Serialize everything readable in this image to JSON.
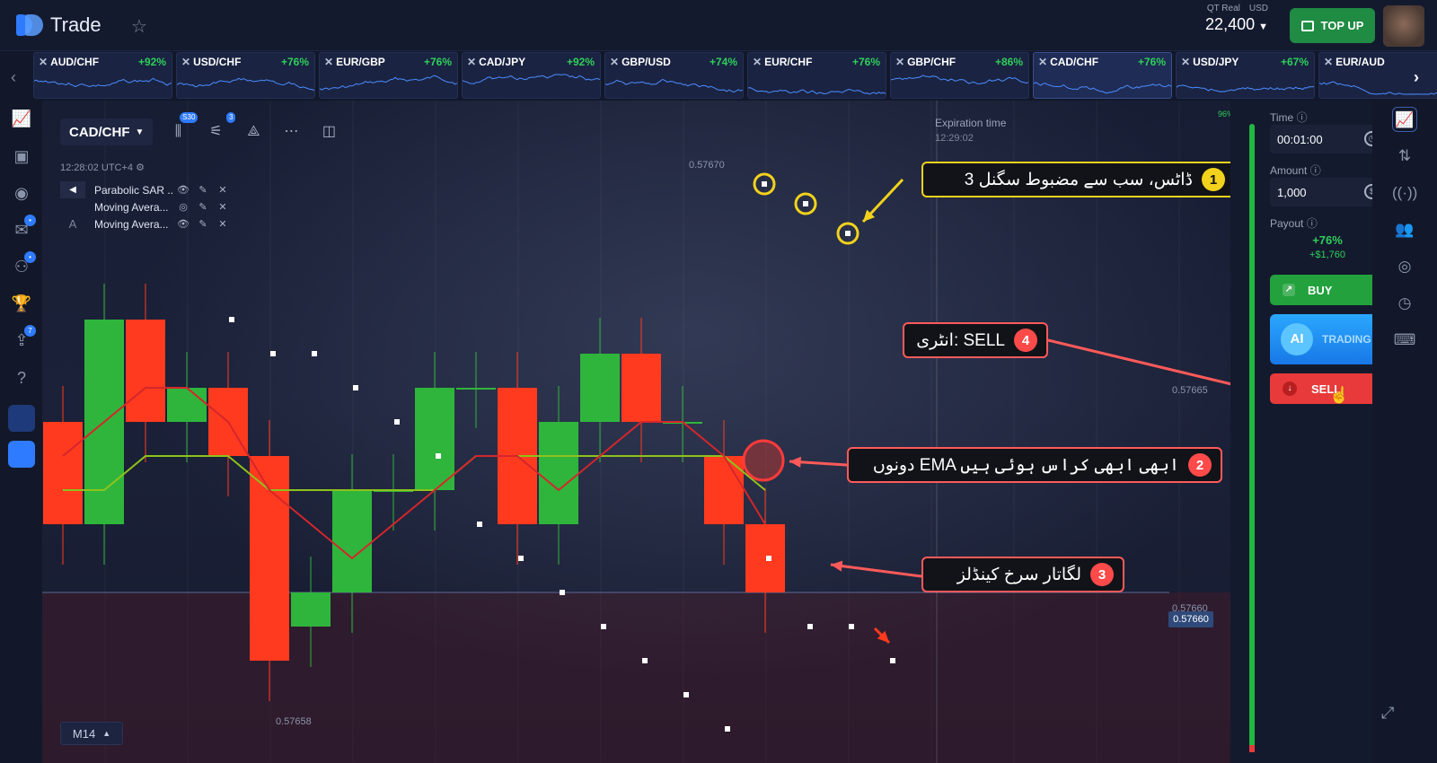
{
  "header": {
    "logo_text": "Trade",
    "account_label": "QT Real",
    "currency": "USD",
    "balance": "22,400",
    "topup_label": "TOP UP"
  },
  "tickers": [
    {
      "pair": "AUD/CHF",
      "payout": "+92%"
    },
    {
      "pair": "USD/CHF",
      "payout": "+76%"
    },
    {
      "pair": "EUR/GBP",
      "payout": "+76%"
    },
    {
      "pair": "CAD/JPY",
      "payout": "+92%"
    },
    {
      "pair": "GBP/USD",
      "payout": "+74%"
    },
    {
      "pair": "EUR/CHF",
      "payout": "+76%"
    },
    {
      "pair": "GBP/CHF",
      "payout": "+86%"
    },
    {
      "pair": "CAD/CHF",
      "payout": "+76%"
    },
    {
      "pair": "USD/JPY",
      "payout": "+67%"
    },
    {
      "pair": "EUR/AUD",
      "payout": ""
    }
  ],
  "chart_panel": {
    "pair": "CAD/CHF",
    "badge_candles": "S30",
    "badge_indicators": "3",
    "clock": "12:28:02 UTC+4",
    "indicators": [
      "Parabolic SAR ...",
      "Moving Avera...",
      "Moving Avera..."
    ],
    "timeframe": "M14",
    "expiration_label": "Expiration time",
    "expiration_time": "12:29:02",
    "price_top": "0.57670",
    "price_mid": "0.57665",
    "price_low": "0.57660",
    "price_current": "0.57660",
    "price_bottom": "0.57658",
    "sentiment": "96%"
  },
  "annotations": {
    "a1": {
      "num": "1",
      "text": "3 ڈاٹس، سب سے مضبوط سگنل"
    },
    "a2": {
      "num": "2",
      "text": "دونوں EMA ابھی ابھی کراس ہوئی ہیں"
    },
    "a3": {
      "num": "3",
      "text": "لگاتار سرخ کینڈلز"
    },
    "a4": {
      "num": "4",
      "text": "انٹری: SELL"
    }
  },
  "trade_panel": {
    "time_label": "Time",
    "time_value": "00:01:00",
    "amount_label": "Amount",
    "amount_value": "1,000",
    "payout_label": "Payout",
    "payout_percent": "+76%",
    "payout_amount": "+$1,760",
    "buy_label": "BUY",
    "ai_label": "AI",
    "ai_trading_label": "TRADING",
    "sell_label": "SELL"
  },
  "colors": {
    "bull": "#2fb53c",
    "bear": "#ff3a1f",
    "ema_fast": "#d4262c",
    "ema_slow": "#8ec21c",
    "annotation_yellow": "#f2d21c",
    "annotation_red": "#ff5a5a"
  },
  "chart_data": {
    "type": "candlestick",
    "candles": [
      {
        "dir": "down",
        "open": 0.57665,
        "close": 0.57662
      },
      {
        "dir": "up",
        "open": 0.57662,
        "close": 0.57668
      },
      {
        "dir": "down",
        "open": 0.57668,
        "close": 0.57665
      },
      {
        "dir": "up",
        "open": 0.57665,
        "close": 0.57666
      },
      {
        "dir": "down",
        "open": 0.57666,
        "close": 0.57664
      },
      {
        "dir": "down",
        "open": 0.57664,
        "close": 0.57658
      },
      {
        "dir": "up",
        "open": 0.57659,
        "close": 0.5766
      },
      {
        "dir": "up",
        "open": 0.5766,
        "close": 0.57663
      },
      {
        "dir": "up",
        "open": 0.57663,
        "close": 0.57663
      },
      {
        "dir": "up",
        "open": 0.57663,
        "close": 0.57666
      },
      {
        "dir": "up",
        "open": 0.57666,
        "close": 0.57666
      },
      {
        "dir": "down",
        "open": 0.57666,
        "close": 0.57662
      },
      {
        "dir": "up",
        "open": 0.57662,
        "close": 0.57665
      },
      {
        "dir": "up",
        "open": 0.57665,
        "close": 0.57667
      },
      {
        "dir": "down",
        "open": 0.57667,
        "close": 0.57665
      },
      {
        "dir": "up",
        "open": 0.57665,
        "close": 0.57665
      },
      {
        "dir": "down",
        "open": 0.57664,
        "close": 0.57662
      },
      {
        "dir": "down",
        "open": 0.57662,
        "close": 0.5766
      }
    ],
    "ema_fast": [
      0.57664,
      0.57665,
      0.57666,
      0.57666,
      0.57665,
      0.57663,
      0.57662,
      0.57661,
      0.57662,
      0.57663,
      0.57664,
      0.57664,
      0.57663,
      0.57664,
      0.57665,
      0.57665,
      0.57664,
      0.57662
    ],
    "ema_slow": [
      0.57663,
      0.57663,
      0.57664,
      0.57664,
      0.57664,
      0.57663,
      0.57663,
      0.57663,
      0.57663,
      0.57663,
      0.57664,
      0.57664,
      0.57664,
      0.57664,
      0.57664,
      0.57664,
      0.57664,
      0.57663
    ],
    "sar_dots": [
      0.57668,
      0.57667,
      0.57667,
      0.57666,
      0.57665,
      0.57664,
      0.57662,
      0.57661,
      0.5766,
      0.57659,
      0.57658,
      0.57657,
      0.57656,
      0.57661,
      0.57659,
      0.57659,
      0.57658
    ],
    "ylim": [
      0.57656,
      0.57671
    ]
  }
}
